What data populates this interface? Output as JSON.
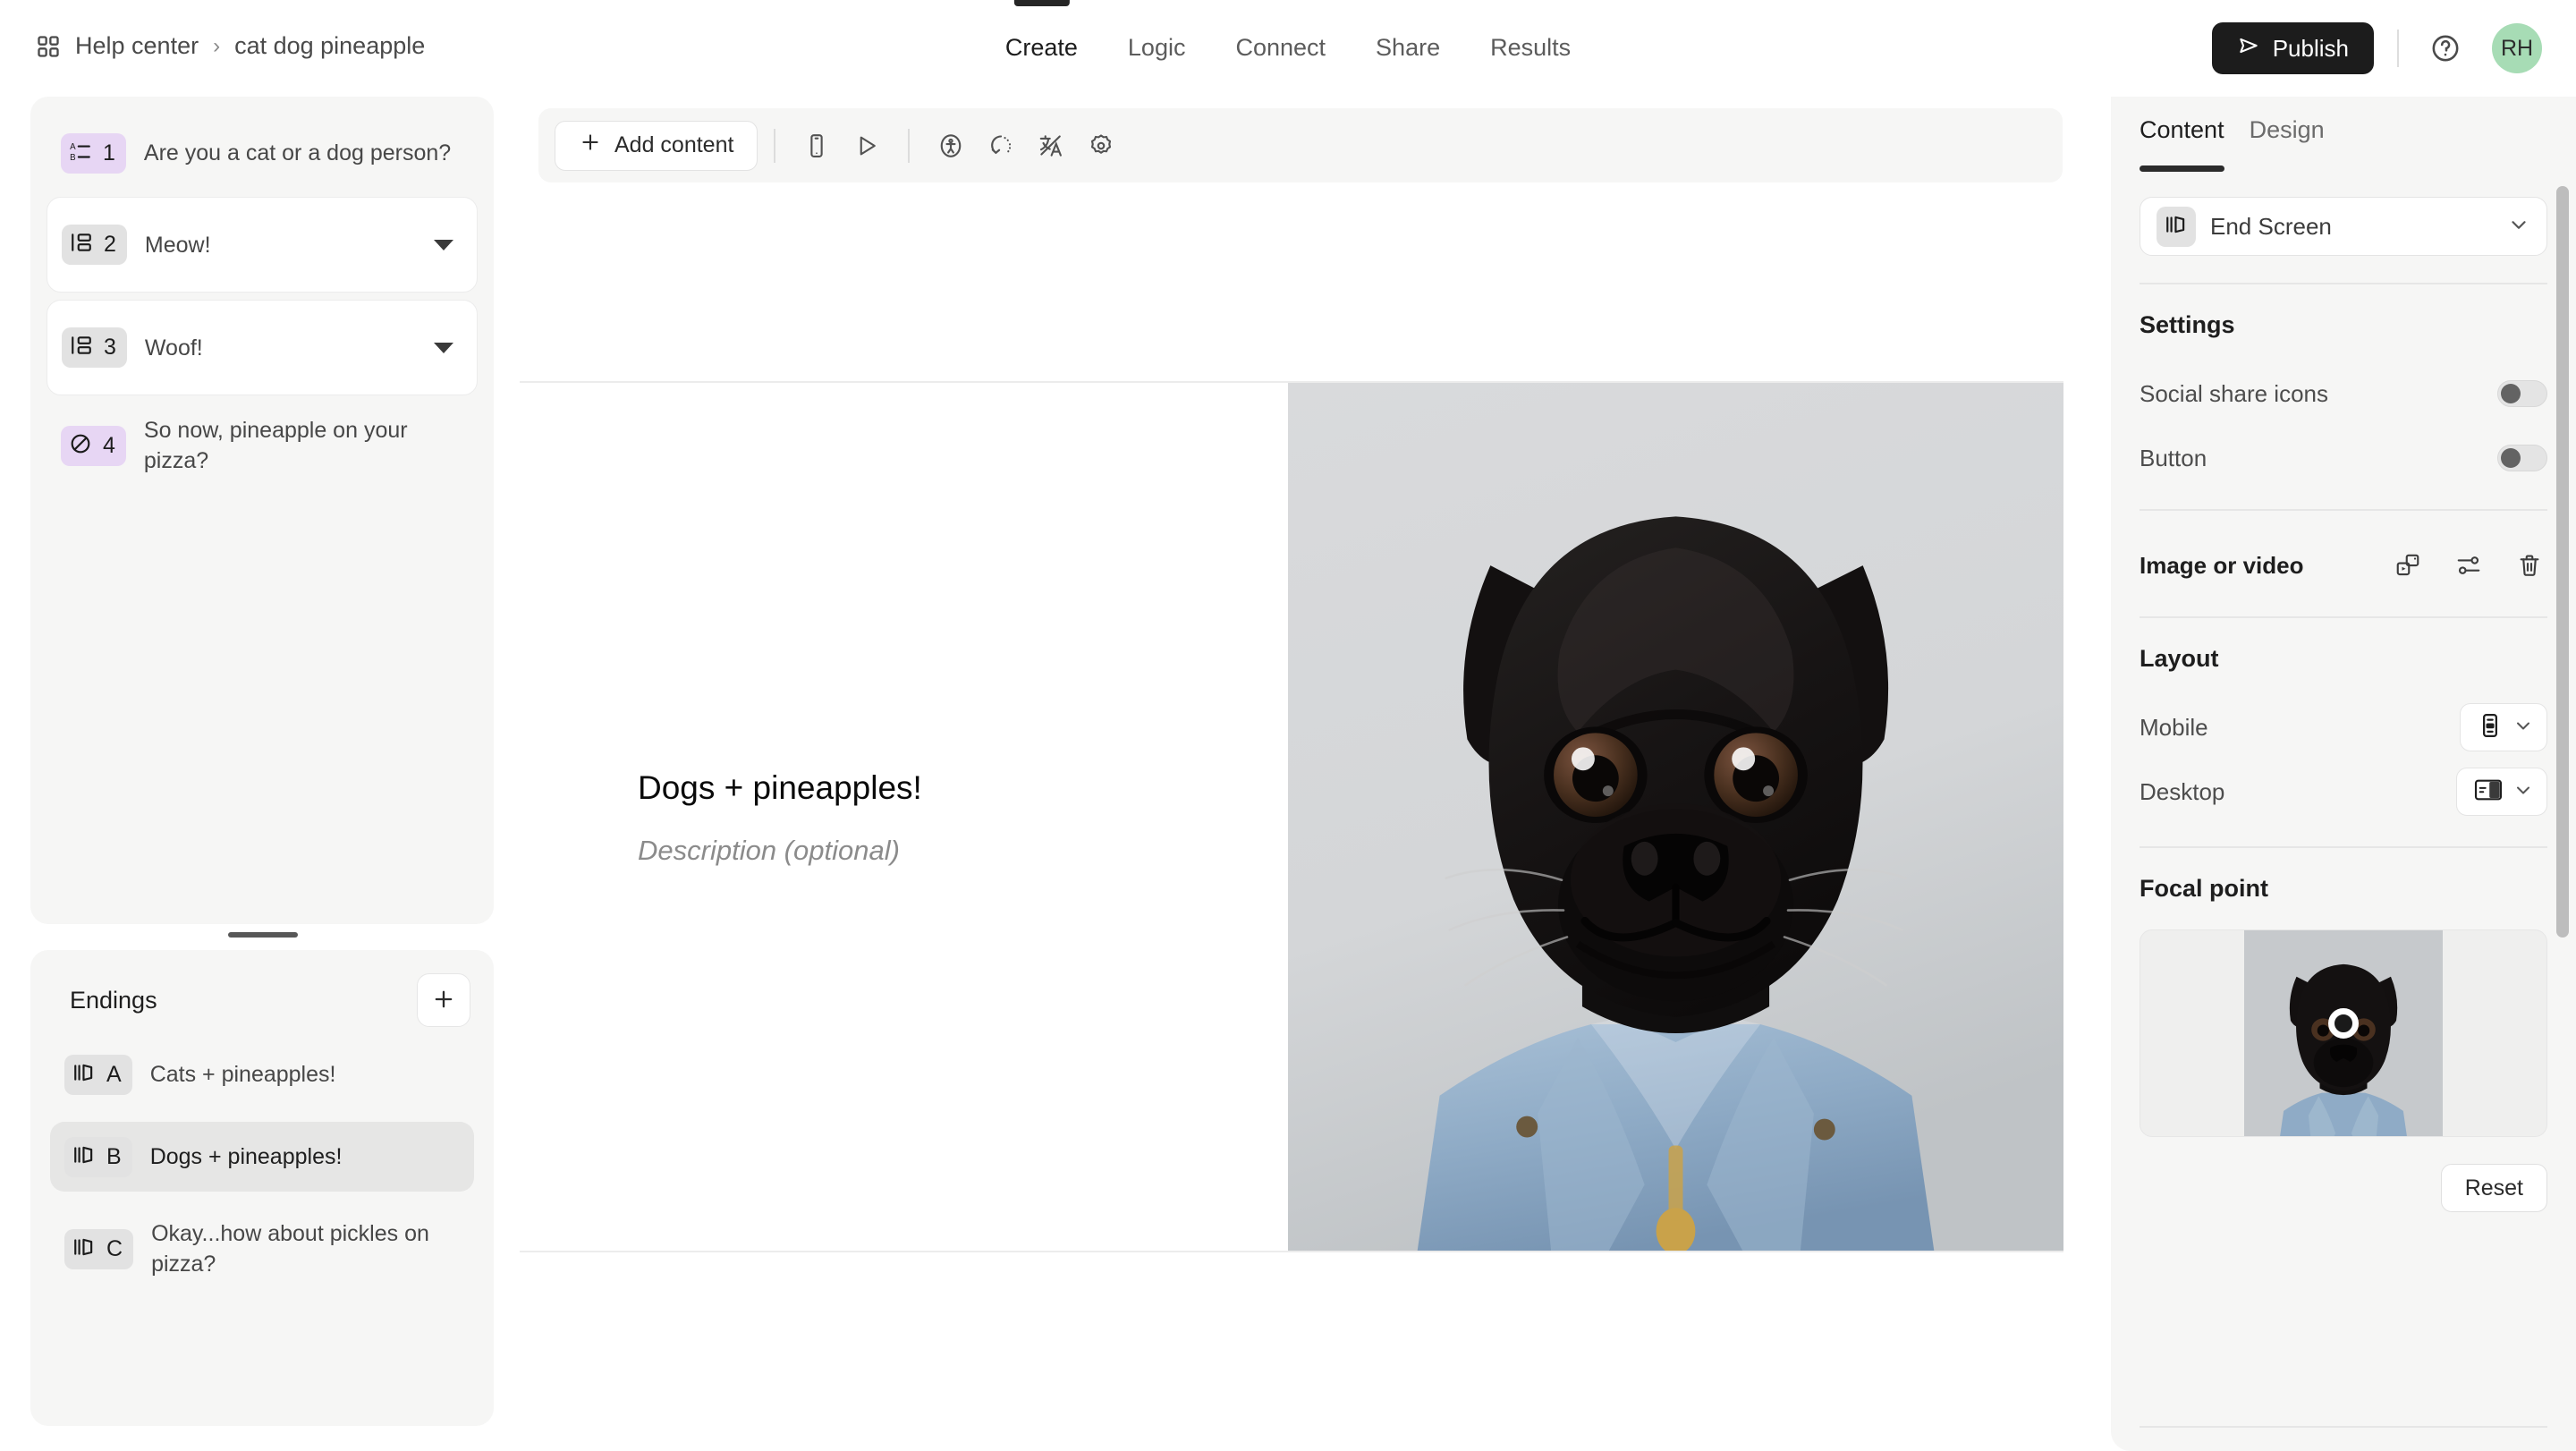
{
  "header": {
    "breadcrumb": {
      "workspace_icon": "grid-icon",
      "workspace": "Help center",
      "separator": "›",
      "current": "cat dog pineapple"
    },
    "tabs": [
      {
        "label": "Create",
        "active": true
      },
      {
        "label": "Logic",
        "active": false
      },
      {
        "label": "Connect",
        "active": false
      },
      {
        "label": "Share",
        "active": false
      },
      {
        "label": "Results",
        "active": false
      }
    ],
    "publish_label": "Publish",
    "publish_icon": "send-icon",
    "help_icon": "help-circle-icon",
    "avatar_initials": "RH",
    "avatar_color": "#a7dcb5",
    "publish_bg": "#1c1c1c"
  },
  "sidebar": {
    "questions": [
      {
        "num": "1",
        "label": "Are you a cat or a dog person?",
        "icon": "multiple-choice-icon",
        "badge_color": "purple",
        "card": false,
        "caret": false
      },
      {
        "num": "2",
        "label": "Meow!",
        "icon": "statement-icon",
        "badge_color": "grey",
        "card": true,
        "caret": true
      },
      {
        "num": "3",
        "label": "Woof!",
        "icon": "statement-icon",
        "badge_color": "grey",
        "card": true,
        "caret": true
      },
      {
        "num": "4",
        "label": "So now, pineapple on your pizza?",
        "icon": "no-symbol-icon",
        "badge_color": "purple",
        "card": false,
        "caret": false
      }
    ],
    "endings": {
      "title": "Endings",
      "add_icon": "plus-icon",
      "items": [
        {
          "num": "A",
          "label": "Cats + pineapples!",
          "icon": "end-screen-icon",
          "selected": false
        },
        {
          "num": "B",
          "label": "Dogs + pineapples!",
          "icon": "end-screen-icon",
          "selected": true
        },
        {
          "num": "C",
          "label": "Okay...how about pickles on pizza?",
          "icon": "end-screen-icon",
          "selected": false
        }
      ]
    }
  },
  "canvas": {
    "toolbar": {
      "add_content_label": "Add content",
      "add_content_icon": "plus-icon",
      "icons": [
        "mobile-preview-icon",
        "play-preview-icon",
        "accessibility-icon",
        "logic-loop-icon",
        "translate-icon",
        "settings-gear-icon"
      ]
    },
    "preview": {
      "title": "Dogs + pineapples!",
      "description_placeholder": "Description (optional)",
      "image_alt": "black-pug-in-denim-jacket"
    }
  },
  "right_panel": {
    "tabs": [
      {
        "label": "Content",
        "active": true
      },
      {
        "label": "Design",
        "active": false
      }
    ],
    "screen_select": {
      "icon": "end-screen-icon",
      "value": "End Screen",
      "chevron": "chevron-down-icon"
    },
    "settings": {
      "title": "Settings",
      "rows": [
        {
          "label": "Social share icons",
          "toggle": "off"
        },
        {
          "label": "Button",
          "toggle": "off"
        }
      ]
    },
    "media": {
      "label": "Image or video",
      "actions": [
        "replace-media-icon",
        "adjust-sliders-icon",
        "trash-icon"
      ]
    },
    "layout": {
      "title": "Layout",
      "rows": [
        {
          "label": "Mobile",
          "icon": "layout-mobile-stacked-icon",
          "chevron": "chevron-down-icon"
        },
        {
          "label": "Desktop",
          "icon": "layout-desktop-split-right-icon",
          "chevron": "chevron-down-icon"
        }
      ]
    },
    "focal_point": {
      "title": "Focal point",
      "reset_label": "Reset",
      "marker": "focal-point-marker"
    }
  }
}
